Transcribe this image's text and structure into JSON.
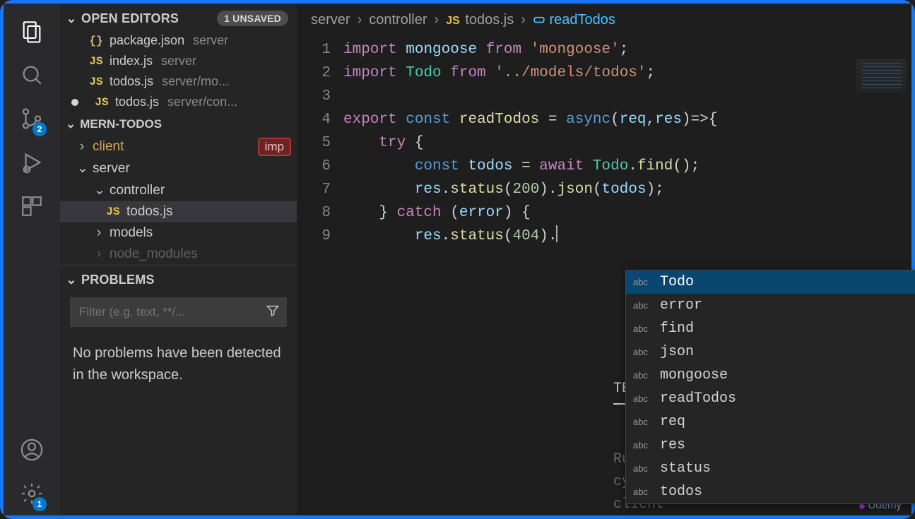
{
  "activity": {
    "scm_badge": "2",
    "settings_badge": "1"
  },
  "sidebar": {
    "open_editors": {
      "title": "OPEN EDITORS",
      "pill": "1 UNSAVED",
      "items": [
        {
          "icon": "{}",
          "name": "package.json",
          "loc": "server",
          "dirty": false,
          "iconClass": "ic-json"
        },
        {
          "icon": "JS",
          "name": "index.js",
          "loc": "server",
          "dirty": false,
          "iconClass": "ic-js"
        },
        {
          "icon": "JS",
          "name": "todos.js",
          "loc": "server/mo...",
          "dirty": false,
          "iconClass": "ic-js"
        },
        {
          "icon": "JS",
          "name": "todos.js",
          "loc": "server/con...",
          "dirty": true,
          "iconClass": "ic-js"
        }
      ]
    },
    "folder": {
      "name": "MERN-TODOS",
      "rows": [
        {
          "indent": 1,
          "chev": "›",
          "label": "client",
          "orange": true,
          "imp": "imp"
        },
        {
          "indent": 1,
          "chev": "⌄",
          "label": "server"
        },
        {
          "indent": 2,
          "chev": "⌄",
          "label": "controller"
        },
        {
          "indent": 3,
          "icon": "JS",
          "label": "todos.js",
          "selected": true
        },
        {
          "indent": 2,
          "chev": "›",
          "label": "models"
        },
        {
          "indent": 2,
          "chev": "›",
          "label": "node_modules",
          "cut": true
        }
      ]
    },
    "problems": {
      "title": "PROBLEMS",
      "placeholder": "Filter (e.g. text, **/...",
      "message": "No problems have been detected in the workspace."
    }
  },
  "breadcrumbs": {
    "b0": "server",
    "b1": "controller",
    "b2": "todos.js",
    "b3": "readTodos"
  },
  "code": {
    "lines": [
      1,
      2,
      3,
      4,
      5,
      6,
      7,
      8,
      9
    ],
    "l1": {
      "a": "import",
      "b": "mongoose",
      "c": "from",
      "d": "'mongoose'",
      "e": ";"
    },
    "l2": {
      "a": "import",
      "b": "Todo",
      "c": "from",
      "d": "'../models/todos'",
      "e": ";"
    },
    "l4": {
      "a": "export",
      "b": "const",
      "c": "readTodos",
      "d": "=",
      "e": "async",
      "f": "(",
      "g": "req",
      "h": ",",
      "i": "res",
      "j": ")=>{`"
    },
    "l5": {
      "a": "try",
      "b": "{"
    },
    "l6": {
      "a": "const",
      "b": "todos",
      "c": "=",
      "d": "await",
      "e": "Todo",
      "f": ".",
      "g": "find",
      "h": "();"
    },
    "l7": {
      "a": "res",
      "b": ".",
      "c": "status",
      "d": "(",
      "e": "200",
      "f": ").",
      "g": "json",
      "h": "(",
      "i": "todos",
      "j": ");"
    },
    "l8": {
      "a": "}",
      "b": "catch",
      "c": "(",
      "d": "error",
      "e": ") {"
    },
    "l9": {
      "a": "res",
      "b": ".",
      "c": "status",
      "d": "(",
      "e": "404",
      "f": ")."
    }
  },
  "suggest": {
    "kind": "abc",
    "items": [
      "Todo",
      "error",
      "find",
      "json",
      "mongoose",
      "readTodos",
      "req",
      "res",
      "status",
      "todos"
    ]
  },
  "terminal": {
    "tab": "TE",
    "line1": "Ru",
    "line2": "cy",
    "line3": "client "
  },
  "footer": {
    "brand": "Udemy"
  }
}
